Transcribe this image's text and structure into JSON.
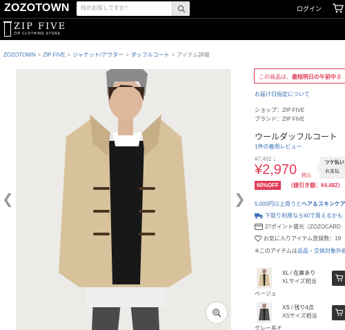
{
  "header": {
    "logo": "ZOZOTOWN",
    "search_placeholder": "何かお探しですか？",
    "login": "ログイン"
  },
  "shop_banner": {
    "name": "ZIP FIVE",
    "subtitle": "ZIP CLOTHING STORE"
  },
  "breadcrumb": [
    "ZOZOTOWN",
    "ZIP FIVE",
    "ジャケット/アウター",
    "ダッフルコート",
    "アイテム詳細"
  ],
  "product": {
    "notice_prefix": "この商品は、",
    "notice_bold": "最短明日の午前中",
    "notice_suffix": "ま",
    "delivery_link": "お届け日指定について",
    "shop_line": "ショップ：ZIP FIVE",
    "brand_line": "ブランド：ZIP FIVE",
    "title": "ウールダッフルコート",
    "reviews": "1件の着用レビュー",
    "old_price": "¥7,452 ↓",
    "price": "¥2,970",
    "tax": "税込",
    "tooltip_title": "ツケ払い",
    "tooltip_text": "お支払",
    "off_badge": "60%OFF",
    "off_detail": "（値引き額：¥4,482）",
    "shipping_prefix": "5,000円以上買うと",
    "shipping_bold": "ヘア＆スキンケア",
    "delivery_row": "下取り利用なら¥0で買えるかも",
    "points_row": "27ポイント還元（ZOZOCARD",
    "fav_row": "お気に入りアイテム登録数：19",
    "note_prefix": "※このアイテムは",
    "note_link": "返品・交換対象外商"
  },
  "variants": [
    {
      "stock": "XL / 在庫あり",
      "size": "XLサイズ相当",
      "color": "ベージュ"
    },
    {
      "stock": "XS / 残り4点",
      "size": "XSサイズ相当",
      "color": "グレー系そ"
    }
  ],
  "colors": {
    "accent": "#e23b56",
    "link": "#3a71b8",
    "header_bg": "#000000"
  }
}
